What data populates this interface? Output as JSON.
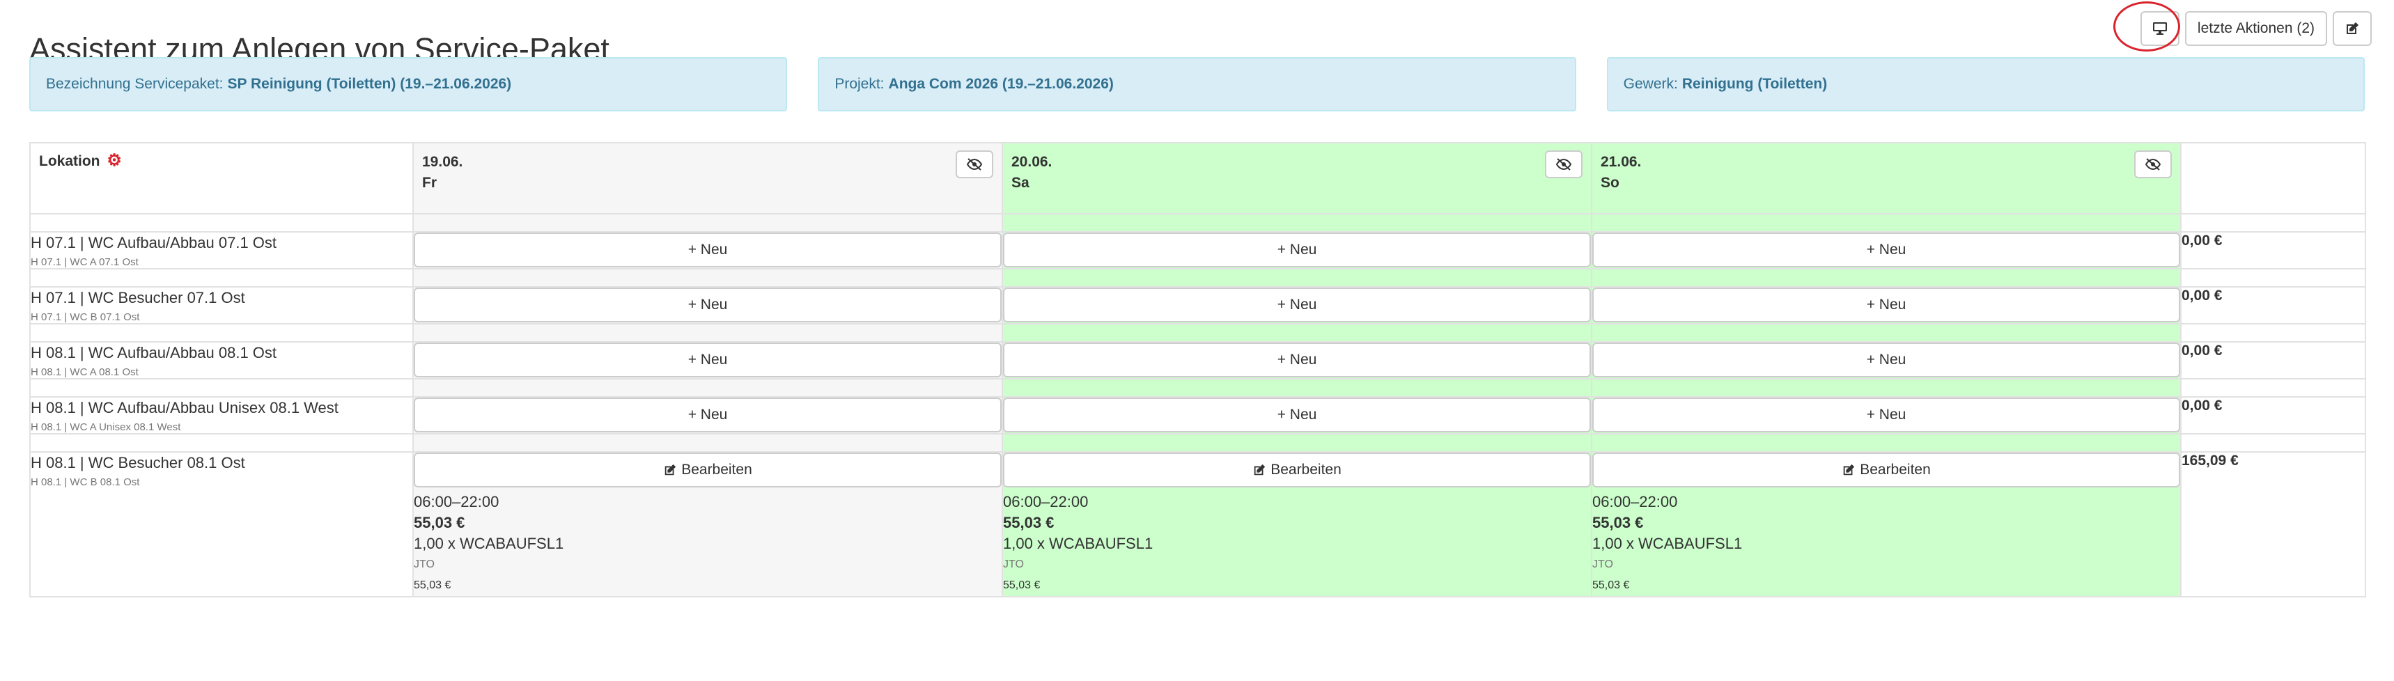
{
  "page": {
    "title": "Assistent zum Anlegen von Service-Paket"
  },
  "toolbar": {
    "last_actions_label": "letzte Aktionen (2)"
  },
  "info": {
    "servicepaket_label": "Bezeichnung Servicepaket:",
    "servicepaket_value": "SP Reinigung (Toiletten) (19.–21.06.2026)",
    "projekt_label": "Projekt:",
    "projekt_value": "Anga Com 2026 (19.–21.06.2026)",
    "gewerk_label": "Gewerk:",
    "gewerk_value": "Reinigung (Toiletten)"
  },
  "table": {
    "location_header": "Lokation",
    "days": [
      {
        "date": "19.06.",
        "weekday": "Fr"
      },
      {
        "date": "20.06.",
        "weekday": "Sa"
      },
      {
        "date": "21.06.",
        "weekday": "So"
      }
    ],
    "new_label": "+ Neu",
    "edit_label": "Bearbeiten",
    "rows": [
      {
        "name": "H 07.1 | WC Aufbau/Abbau 07.1 Ost",
        "sub": "H 07.1 | WC A 07.1 Ost",
        "sum": "0,00 €"
      },
      {
        "name": "H 07.1 | WC Besucher 07.1 Ost",
        "sub": "H 07.1 | WC B 07.1 Ost",
        "sum": "0,00 €"
      },
      {
        "name": "H 08.1 | WC Aufbau/Abbau 08.1 Ost",
        "sub": "H 08.1 | WC A 08.1 Ost",
        "sum": "0,00 €"
      },
      {
        "name": "H 08.1 | WC Aufbau/Abbau Unisex 08.1 West",
        "sub": "H 08.1 | WC A Unisex 08.1 West",
        "sum": "0,00 €"
      },
      {
        "name": "H 08.1 | WC Besucher 08.1 Ost",
        "sub": "H 08.1 | WC B 08.1 Ost",
        "sum": "165,09 €",
        "slots": [
          {
            "time": "06:00–22:00",
            "price": "55,03 €",
            "qty": "1,00 x WCABAUFSL1",
            "code": "JTO",
            "subtotal": "55,03 €"
          },
          {
            "time": "06:00–22:00",
            "price": "55,03 €",
            "qty": "1,00 x WCABAUFSL1",
            "code": "JTO",
            "subtotal": "55,03 €"
          },
          {
            "time": "06:00–22:00",
            "price": "55,03 €",
            "qty": "1,00 x WCABAUFSL1",
            "code": "JTO",
            "subtotal": "55,03 €"
          }
        ]
      }
    ]
  },
  "icons": {
    "monitor": "monitor-icon",
    "edit": "edit-icon",
    "gear": "gear-icon",
    "eye_off": "eye-off-icon"
  },
  "colors": {
    "weekend_bg": "#ccffcc",
    "weekday_bg": "#f6f6f6",
    "info_bg": "#d9edf7",
    "info_text": "#31708f",
    "highlight": "#d9232d"
  }
}
